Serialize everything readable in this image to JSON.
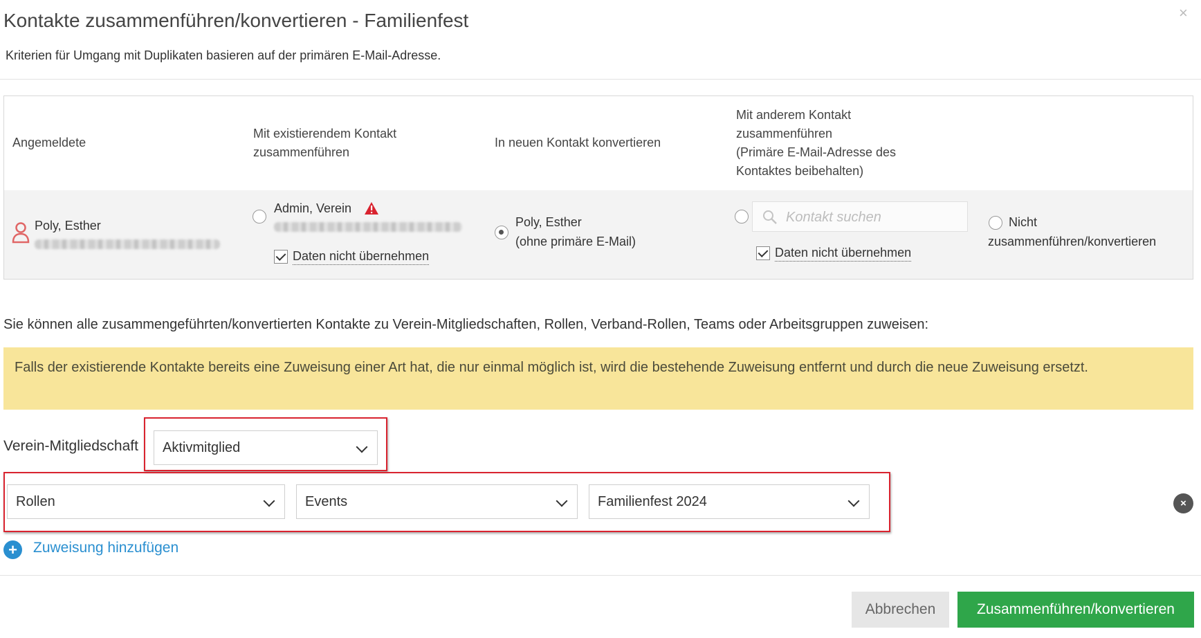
{
  "header": {
    "title": "Kontakte zusammenführen/konvertieren - Familienfest",
    "subtitle": "Kriterien für Umgang mit Duplikaten basieren auf der primären E-Mail-Adresse.",
    "close_label": "×"
  },
  "table": {
    "columns": {
      "registered": "Angemeldete",
      "merge_existing_1": "Mit existierendem Kontakt",
      "merge_existing_2": "zusammenführen",
      "convert_new": "In neuen Kontakt konvertieren",
      "merge_other_1": "Mit anderem Kontakt",
      "merge_other_2": "zusammenführen",
      "merge_other_3": "(Primäre E-Mail-Adresse des",
      "merge_other_4": "Kontaktes beibehalten)"
    },
    "row": {
      "registrant_name": "Poly, Esther",
      "existing_contact": "Admin, Verein",
      "no_data_transfer": "Daten nicht übernehmen",
      "new_contact_name": "Poly, Esther",
      "new_contact_note": "(ohne primäre E-Mail)",
      "search_placeholder": "Kontakt suchen",
      "no_data_transfer_2": "Daten nicht übernehmen",
      "not_merge_1": "Nicht",
      "not_merge_2": "zusammenführen/konvertieren",
      "selected_option": "convert_new"
    }
  },
  "assign_text": "Sie können alle zusammengeführten/konvertierten Kontakte zu Verein-Mitgliedschaften, Rollen, Verband-Rollen, Teams oder Arbeitsgruppen zuweisen:",
  "warning": "Falls der existierende Kontakte bereits eine Zuweisung einer Art hat, die nur einmal möglich ist, wird die bestehende Zuweisung entfernt und durch die neue Zuweisung ersetzt.",
  "membership": {
    "label": "Verein-Mitgliedschaft",
    "value": "Aktivmitglied"
  },
  "assignment": {
    "type": "Rollen",
    "category": "Events",
    "event": "Familienfest 2024",
    "remove_label": "×"
  },
  "add_assignment": {
    "icon": "+",
    "label": "Zuweisung hinzufügen"
  },
  "footer": {
    "cancel": "Abbrechen",
    "submit": "Zusammenführen/konvertieren"
  },
  "colors": {
    "primary_button": "#2fa64a",
    "link": "#2a8fd0",
    "warning_bg": "#f8e59a",
    "annotation_red": "#d9232f",
    "error_icon": "#d9232f",
    "user_icon": "#e06666"
  }
}
